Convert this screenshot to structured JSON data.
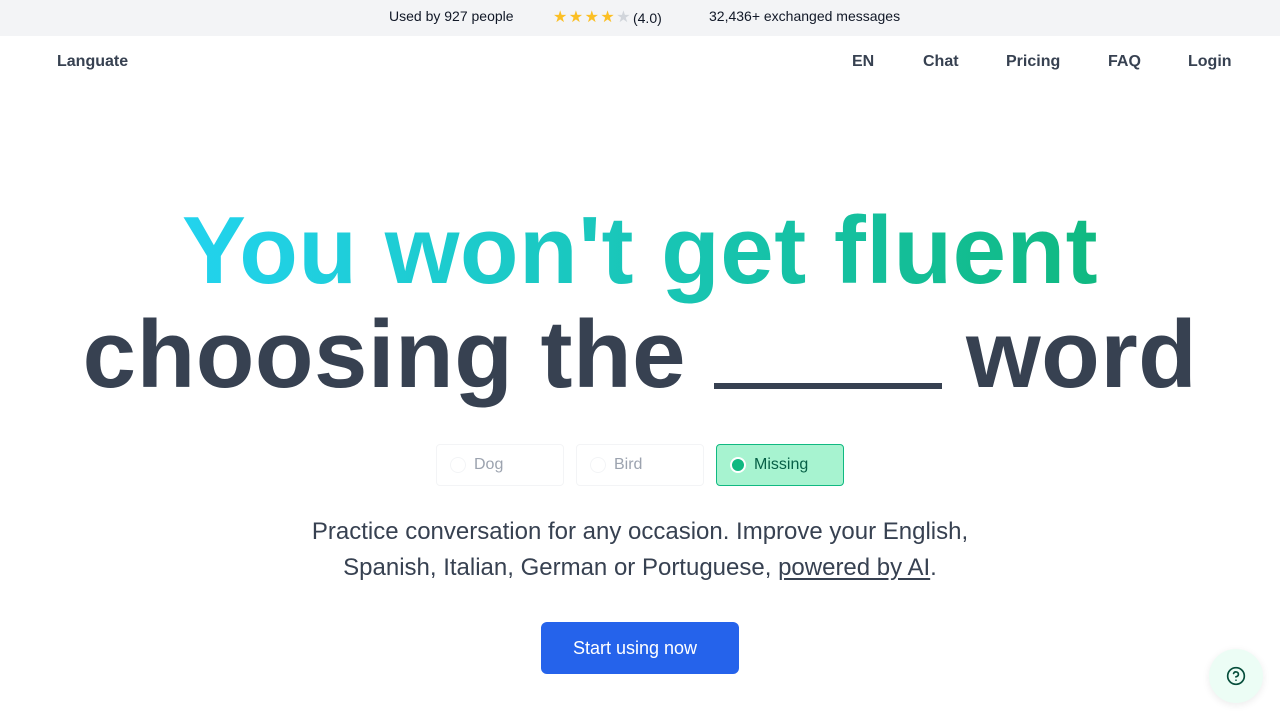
{
  "topbar": {
    "users_text": "Used by 927 people",
    "rating": {
      "value": 4.0,
      "max": 5,
      "label": "(4.0)",
      "star_on_color": "#fbbf24",
      "star_off_color": "#d1d5db"
    },
    "messages_text": "32,436+ exchanged messages"
  },
  "nav": {
    "brand": "Languate",
    "links": [
      {
        "label": "EN"
      },
      {
        "label": "Chat"
      },
      {
        "label": "Pricing"
      },
      {
        "label": "FAQ"
      },
      {
        "label": "Login"
      }
    ]
  },
  "hero": {
    "line1": "You won't get fluent",
    "line2_before": "choosing the",
    "line2_after": "word",
    "gradient_colors": [
      "#22d3ee",
      "#10b981"
    ],
    "options": [
      {
        "label": "Dog",
        "selected": false
      },
      {
        "label": "Bird",
        "selected": false
      },
      {
        "label": "Missing",
        "selected": true
      }
    ],
    "subtitle_line1": "Practice conversation for any occasion. Improve your English,",
    "subtitle_line2": "Spanish, Italian, German or Portuguese,",
    "subtitle_link": "powered by AI",
    "subtitle_end": ".",
    "cta_label": "Start using now",
    "accent_color": "#2563eb"
  },
  "help_button": {
    "icon": "question-circle-icon"
  }
}
